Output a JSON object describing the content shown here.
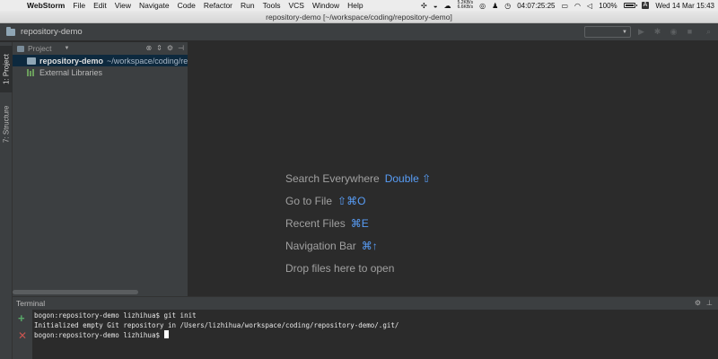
{
  "menubar": {
    "app_name": "WebStorm",
    "items": [
      "File",
      "Edit",
      "View",
      "Navigate",
      "Code",
      "Refactor",
      "Run",
      "Tools",
      "VCS",
      "Window",
      "Help"
    ],
    "net_up": "5.2KB/s",
    "net_down": "6.6KB/s",
    "uptime": "04:07:25:25",
    "battery": "100%",
    "battery_level": 1.0,
    "input_method": "A",
    "datetime": "Wed 14 Mar  15:43"
  },
  "window": {
    "title": "repository-demo [~/workspace/coding/repository-demo]"
  },
  "navbar": {
    "breadcrumb": "repository-demo"
  },
  "tool_stripe": {
    "project_tab": "1: Project",
    "structure_tab": "7: Structure"
  },
  "project_panel": {
    "header_label": "Project",
    "tree": [
      {
        "name": "repository-demo",
        "path": "~/workspace/coding/repository-demo",
        "selected": true
      },
      {
        "name": "External Libraries"
      }
    ]
  },
  "editor_hints": [
    {
      "label": "Search Everywhere",
      "key": "Double ⇧"
    },
    {
      "label": "Go to File",
      "key": "⇧⌘O"
    },
    {
      "label": "Recent Files",
      "key": "⌘E"
    },
    {
      "label": "Navigation Bar",
      "key": "⌘↑"
    },
    {
      "label": "Drop files here to open",
      "key": ""
    }
  ],
  "terminal": {
    "title": "Terminal",
    "lines": [
      "bogon:repository-demo lizhihua$ git init",
      "Initialized empty Git repository in /Users/lizhihua/workspace/coding/repository-demo/.git/",
      "bogon:repository-demo lizhihua$ "
    ]
  },
  "colors": {
    "accent_key": "#589df6",
    "add_icon": "#59a869",
    "close_icon": "#c75450",
    "selection": "#0d293e"
  }
}
